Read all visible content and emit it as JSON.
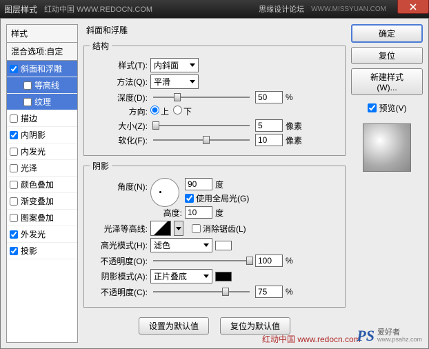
{
  "titlebar": {
    "title": "图层样式",
    "brand_left": "红动中国 WWW.REDOCN.COM",
    "brand_right": "思缘设计论坛",
    "brand_right_url": "WWW.MISSYUAN.COM"
  },
  "sidebar": {
    "header": "样式",
    "sub": "混合选项:自定",
    "items": [
      {
        "label": "斜面和浮雕",
        "checked": true,
        "selected": true,
        "indent": false
      },
      {
        "label": "等高线",
        "checked": false,
        "selected": true,
        "indent": true
      },
      {
        "label": "纹理",
        "checked": false,
        "selected": true,
        "indent": true
      },
      {
        "label": "描边",
        "checked": false,
        "selected": false,
        "indent": false
      },
      {
        "label": "内阴影",
        "checked": true,
        "selected": false,
        "indent": false
      },
      {
        "label": "内发光",
        "checked": false,
        "selected": false,
        "indent": false
      },
      {
        "label": "光泽",
        "checked": false,
        "selected": false,
        "indent": false
      },
      {
        "label": "颜色叠加",
        "checked": false,
        "selected": false,
        "indent": false
      },
      {
        "label": "渐变叠加",
        "checked": false,
        "selected": false,
        "indent": false
      },
      {
        "label": "图案叠加",
        "checked": false,
        "selected": false,
        "indent": false
      },
      {
        "label": "外发光",
        "checked": true,
        "selected": false,
        "indent": false
      },
      {
        "label": "投影",
        "checked": true,
        "selected": false,
        "indent": false
      }
    ]
  },
  "panel": {
    "title": "斜面和浮雕",
    "structure": {
      "legend": "结构",
      "style_label": "样式(T):",
      "style_value": "内斜面",
      "method_label": "方法(Q):",
      "method_value": "平滑",
      "depth_label": "深度(D):",
      "depth_value": "50",
      "depth_unit": "%",
      "direction_label": "方向:",
      "up": "上",
      "down": "下",
      "size_label": "大小(Z):",
      "size_value": "5",
      "size_unit": "像素",
      "soften_label": "软化(F):",
      "soften_value": "10",
      "soften_unit": "像素"
    },
    "shadow": {
      "legend": "阴影",
      "angle_label": "角度(N):",
      "angle_value": "90",
      "angle_unit": "度",
      "global_label": "使用全局光(G)",
      "altitude_label": "高度:",
      "altitude_value": "10",
      "altitude_unit": "度",
      "gloss_label": "光泽等高线:",
      "anti_label": "消除锯齿(L)",
      "hl_mode_label": "高光模式(H):",
      "hl_mode_value": "滤色",
      "hl_op_label": "不透明度(O):",
      "hl_op_value": "100",
      "hl_op_unit": "%",
      "sh_mode_label": "阴影模式(A):",
      "sh_mode_value": "正片叠底",
      "sh_op_label": "不透明度(C):",
      "sh_op_value": "75",
      "sh_op_unit": "%"
    },
    "buttons": {
      "default": "设置为默认值",
      "reset": "复位为默认值"
    }
  },
  "right": {
    "ok": "确定",
    "cancel": "复位",
    "new_style": "新建样式(W)...",
    "preview_label": "预览(V)"
  },
  "footer": {
    "cn": "红动中国 www.redocn.com",
    "ps": "PS",
    "ps_sub": "爱好者",
    "url": "www.psahz.com"
  },
  "colors": {
    "hl": "#ffffff",
    "sh": "#000000"
  }
}
